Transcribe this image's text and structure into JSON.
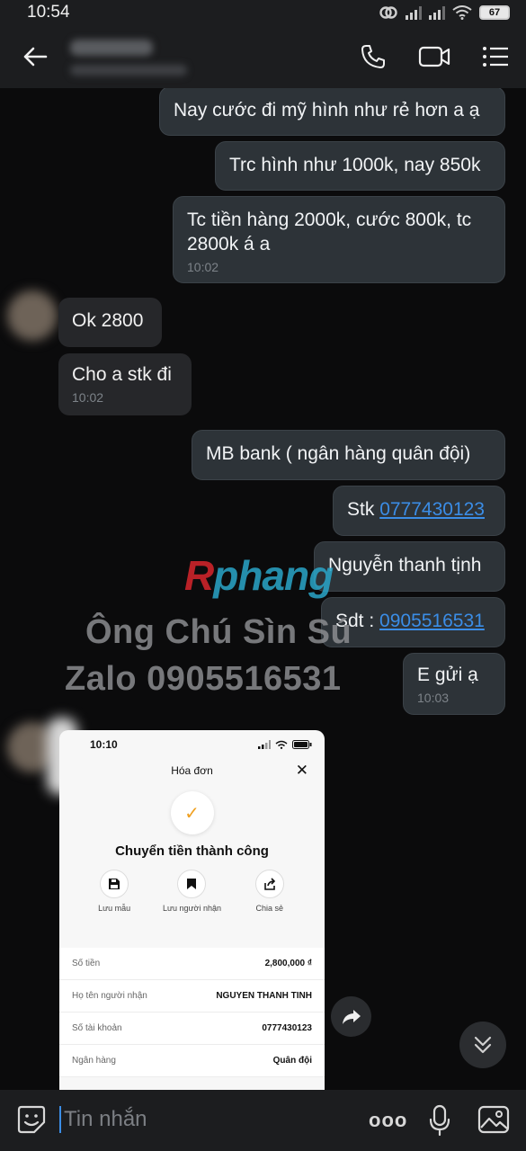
{
  "status_bar": {
    "time": "10:54",
    "battery": "67"
  },
  "header": {
    "back_icon": "arrow-left-icon",
    "call_icon": "phone-icon",
    "video_icon": "video-camera-icon",
    "menu_icon": "list-menu-icon"
  },
  "messages": [
    {
      "dir": "out",
      "text": "Nay cước đi mỹ hình như rẻ hơn a ạ"
    },
    {
      "dir": "out",
      "text": "Trc hình như 1000k, nay 850k"
    },
    {
      "dir": "out",
      "text": "Tc tiền hàng 2000k, cước 800k, tc 2800k á a",
      "time": "10:02"
    },
    {
      "dir": "in",
      "text": "Ok 2800"
    },
    {
      "dir": "in",
      "text": "Cho a stk đi",
      "time": "10:02"
    },
    {
      "dir": "out",
      "text": "MB bank ( ngân hàng quân đội)"
    },
    {
      "dir": "out",
      "prefix": "Stk ",
      "link": "0777430123"
    },
    {
      "dir": "out",
      "text": "Nguyễn thanh tịnh"
    },
    {
      "dir": "out",
      "prefix": "Sdt : ",
      "link": "0905516531"
    },
    {
      "dir": "out",
      "text": "E gửi ạ",
      "time": "10:03"
    }
  ],
  "watermark": {
    "logo_r": "R",
    "logo_rest": "phang",
    "line1": "Ông Chú Sìn Sú",
    "line2": "Zalo 0905516531"
  },
  "receipt": {
    "time": "10:10",
    "title": "Hóa đơn",
    "close": "✕",
    "success": "Chuyển tiền thành công",
    "actions": [
      {
        "icon": "save-icon",
        "label": "Lưu mẫu"
      },
      {
        "icon": "bookmark-icon",
        "label": "Lưu người nhận"
      },
      {
        "icon": "share-icon",
        "label": "Chia sẻ"
      }
    ],
    "rows": [
      {
        "key": "Số tiền",
        "value": "2,800,000 ₫"
      },
      {
        "key": "Họ tên người nhận",
        "value": "NGUYEN THANH TINH"
      },
      {
        "key": "Số tài khoản",
        "value": "0777430123"
      },
      {
        "key": "Ngân hàng",
        "value": "Quân đội"
      }
    ]
  },
  "composer": {
    "placeholder": "Tin nhắn",
    "more": "ooo"
  }
}
